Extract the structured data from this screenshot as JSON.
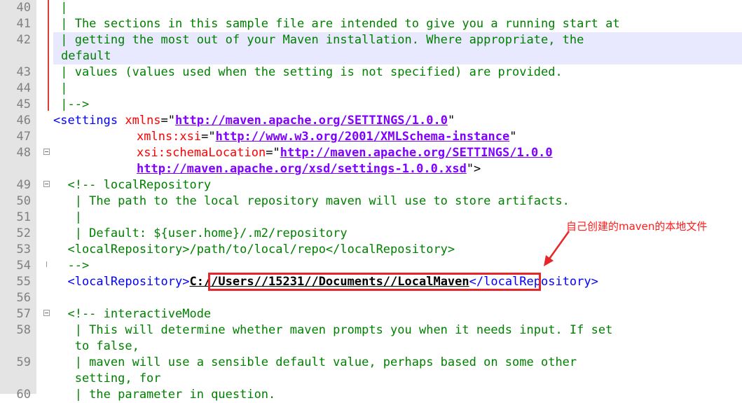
{
  "editor": {
    "lines": [
      {
        "num": "40",
        "text": " |"
      },
      {
        "num": "41",
        "text": " | The sections in this sample file are intended to give you a running start at"
      },
      {
        "num": "42",
        "text": " | getting the most out of your Maven installation. Where appropriate, the"
      },
      {
        "num": "",
        "text": "default"
      },
      {
        "num": "43",
        "text": " | values (values used when the setting is not specified) are provided."
      },
      {
        "num": "44",
        "text": " |"
      },
      {
        "num": "45",
        "text": " |-->"
      },
      {
        "num": "46",
        "parts": {
          "tag": "<settings",
          "attr": " xmlns",
          "eq": "=\"",
          "val": "http://maven.apache.org/SETTINGS/1.0.0",
          "end": "\""
        }
      },
      {
        "num": "47",
        "parts": {
          "attr": "xmlns:xsi",
          "eq": "=\"",
          "val": "http://www.w3.org/2001/XMLSchema-instance",
          "end": "\""
        }
      },
      {
        "num": "48",
        "parts": {
          "attr": "xsi:schemaLocation",
          "eq": "=\"",
          "val": "http://maven.apache.org/SETTINGS/1.0.0"
        }
      },
      {
        "num": "",
        "parts": {
          "val": "http://maven.apache.org/xsd/settings-1.0.0.xsd",
          "end": "\">"
        }
      },
      {
        "num": "49",
        "text": "  <!-- localRepository"
      },
      {
        "num": "50",
        "text": "   | The path to the local repository maven will use to store artifacts."
      },
      {
        "num": "51",
        "text": "   |"
      },
      {
        "num": "52",
        "text": "   | Default: ${user.home}/.m2/repository"
      },
      {
        "num": "53",
        "text": "  <localRepository>/path/to/local/repo</localRepository>"
      },
      {
        "num": "54",
        "text": "  -->"
      },
      {
        "num": "55",
        "parts": {
          "open": "  <localRepository>",
          "val": "C://Users//15231//Documents//LocalMaven",
          "close": "</localRepository>"
        }
      },
      {
        "num": "56",
        "text": ""
      },
      {
        "num": "57",
        "text": "  <!-- interactiveMode"
      },
      {
        "num": "58",
        "text": "   | This will determine whether maven prompts you when it needs input. If set"
      },
      {
        "num": "",
        "text": "   to false,"
      },
      {
        "num": "59",
        "text": "   | maven will use a sensible default value, perhaps based on some other"
      },
      {
        "num": "",
        "text": "   setting, for"
      },
      {
        "num": "60",
        "text": "   | the parameter in question."
      }
    ]
  },
  "annotation": {
    "text": "自己创建的maven的本地文件",
    "color": "#ff1a1a"
  }
}
